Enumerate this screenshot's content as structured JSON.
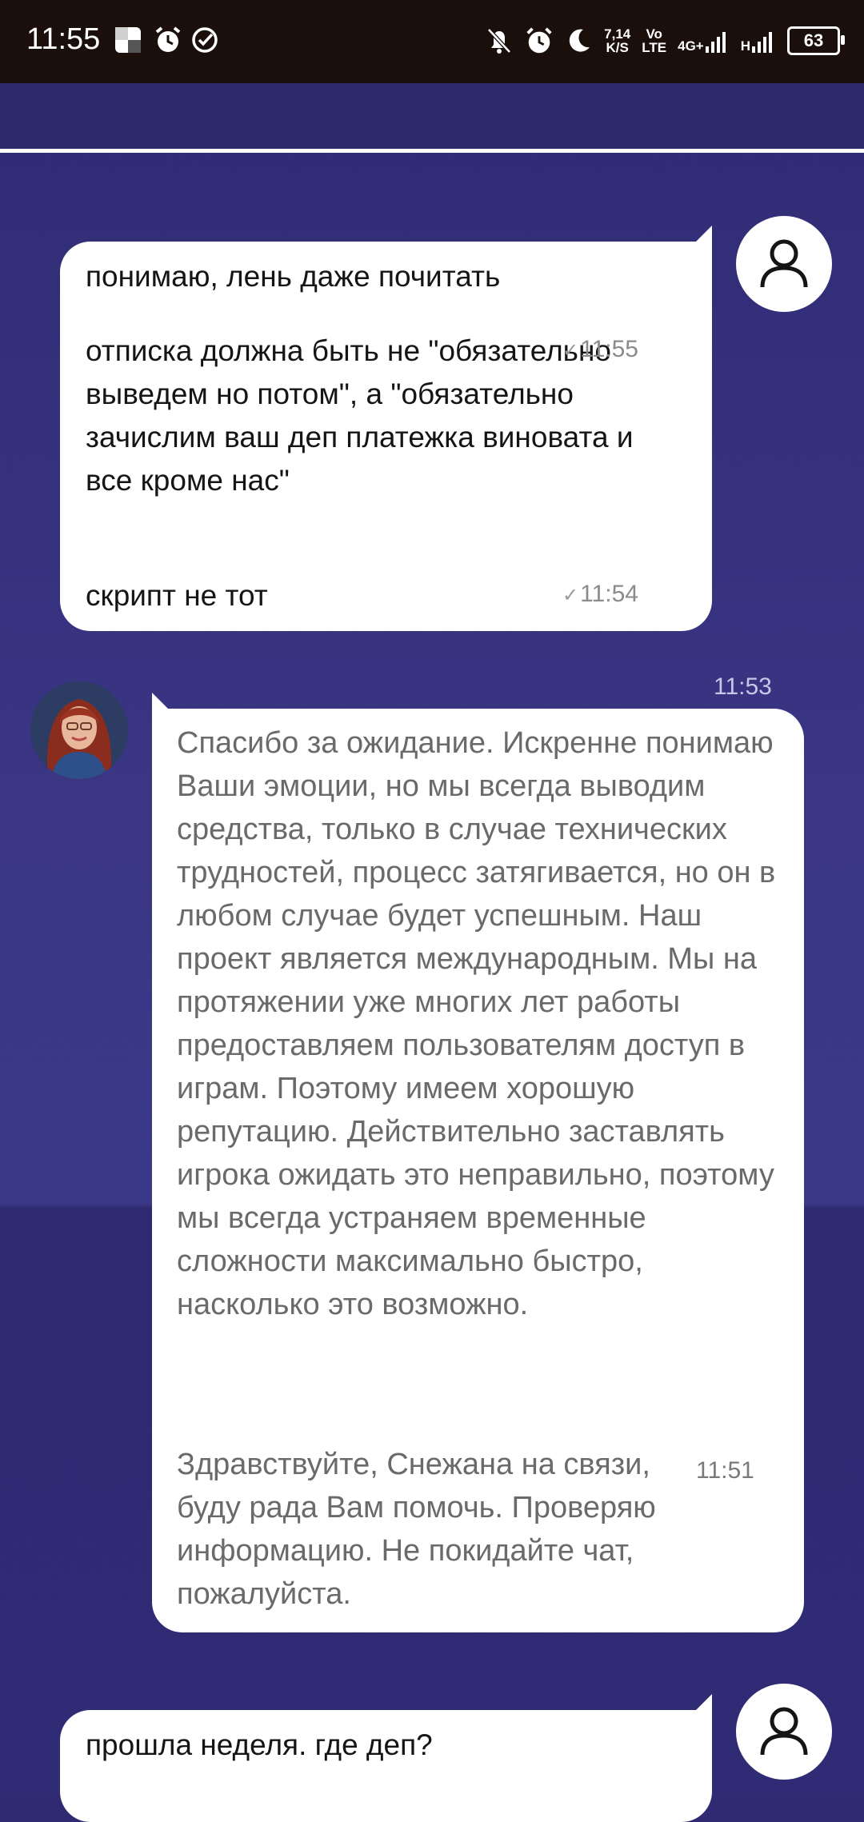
{
  "status_bar": {
    "time": "11:55",
    "speed_value": "7,14",
    "speed_unit": "K/S",
    "volte_top": "Vo",
    "volte_bottom": "LTE",
    "network": "4G+",
    "network2": "H",
    "battery": "63"
  },
  "messages": {
    "user_block_1": {
      "line1": "понимаю, лень даже почитать",
      "line2": "отписка должна быть не \"обязательно выведем но потом\", а \"обязательно зачислим ваш деп платежка виновата и все кроме нас\"",
      "line2_time": "11:55",
      "line3": "скрипт не тот",
      "line3_time": "11:54"
    },
    "agent_block": {
      "header_time": "11:53",
      "message1": "Спасибо за ожидание. Искренне понимаю Ваши эмоции, но мы всегда выводим средства, только в случае технических трудностей, процесс затягивается, но он в любом случае будет успешным. Наш проект является международным. Мы на протяжении уже многих лет работы предоставляем пользователям доступ в играм. Поэтому имеем хорошую репутацию. Действительно заставлять игрока ожидать это неправильно, поэтому мы всегда устраняем временные сложности максимально быстро, насколько это возможно.",
      "message2": "Здравствуйте, Снежана на связи, буду рада Вам помочь. Проверяю информацию. Не покидайте чат, пожалуйста.",
      "message2_time": "11:51"
    },
    "user_block_2": {
      "line1": "прошла неделя. где деп?"
    }
  },
  "colors": {
    "background": "#352f7a",
    "bubble": "#ffffff",
    "status_bar": "#1a0f0b"
  }
}
